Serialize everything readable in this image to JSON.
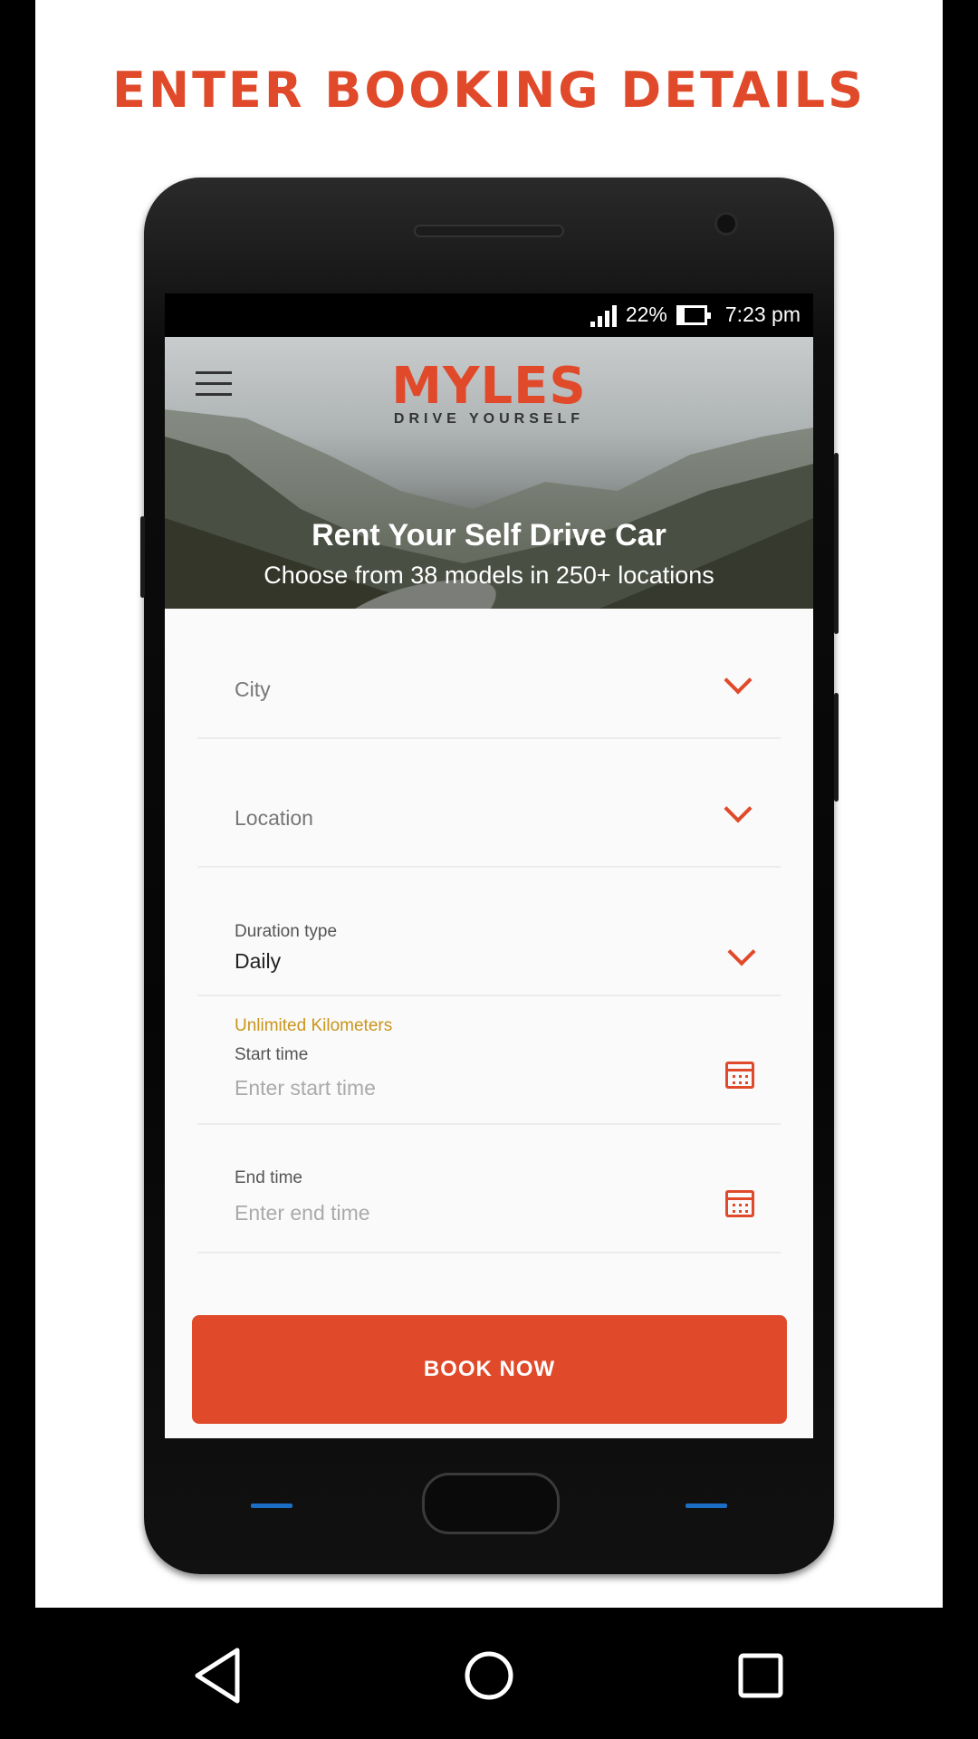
{
  "headline": "ENTER BOOKING DETAILS",
  "status": {
    "battery": "22%",
    "time": "7:23 pm"
  },
  "header": {
    "logo": "MYLES",
    "tagline": "DRIVE YOURSELF",
    "hero_title": "Rent Your Self Drive Car",
    "hero_subtitle": "Choose from 38 models in 250+ locations"
  },
  "form": {
    "city": {
      "placeholder": "City"
    },
    "location": {
      "placeholder": "Location"
    },
    "duration": {
      "label": "Duration type",
      "value": "Daily"
    },
    "note": "Unlimited Kilometers",
    "start": {
      "label": "Start time",
      "placeholder": "Enter start time"
    },
    "end": {
      "label": "End time",
      "placeholder": "Enter end time"
    },
    "submit": "BOOK NOW"
  },
  "colors": {
    "accent": "#e04a2a",
    "note": "#c9951c"
  },
  "icons": [
    "menu-icon",
    "chevron-down-icon",
    "calendar-icon",
    "signal-icon",
    "battery-icon",
    "back-icon",
    "home-icon",
    "recents-icon"
  ]
}
